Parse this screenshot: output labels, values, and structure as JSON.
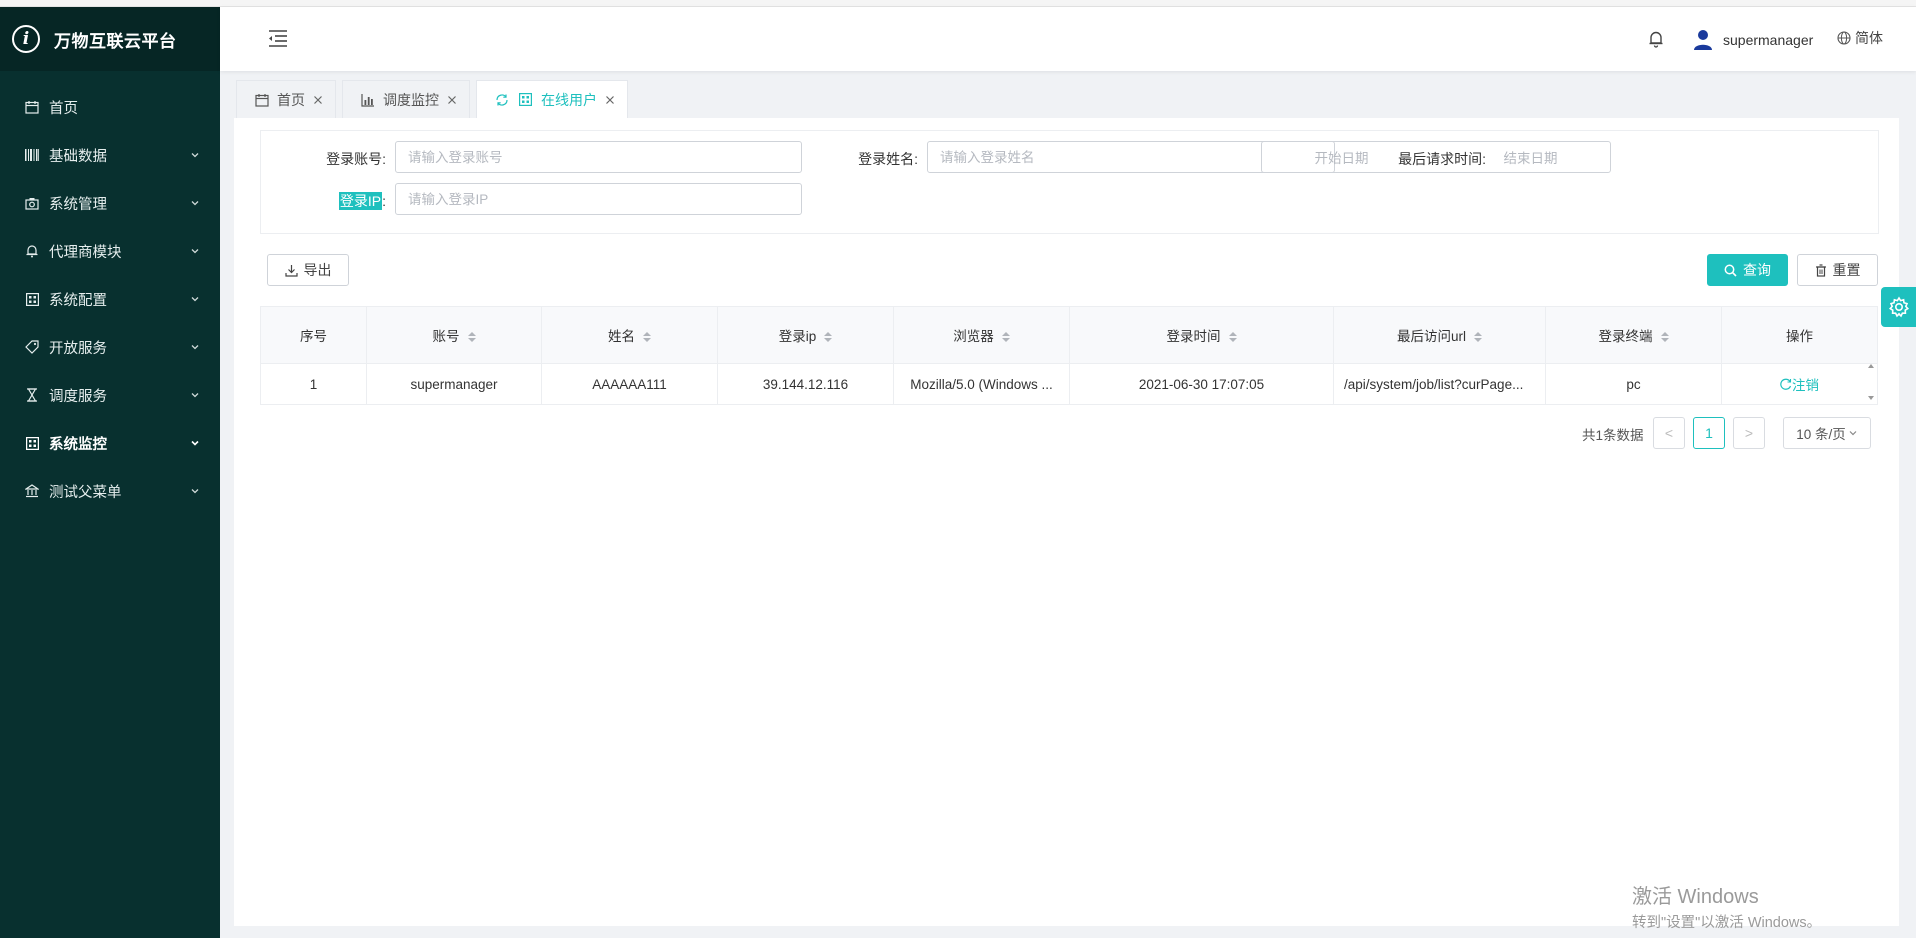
{
  "app": {
    "title": "万物互联云平台"
  },
  "sidebar": {
    "items": [
      {
        "label": "首页",
        "icon": "calendar-icon",
        "has_children": false,
        "active": false
      },
      {
        "label": "基础数据",
        "icon": "barcode-icon",
        "has_children": true,
        "active": false
      },
      {
        "label": "系统管理",
        "icon": "camera-icon",
        "has_children": true,
        "active": false
      },
      {
        "label": "代理商模块",
        "icon": "bell-icon",
        "has_children": true,
        "active": false
      },
      {
        "label": "系统配置",
        "icon": "grid-icon",
        "has_children": true,
        "active": false
      },
      {
        "label": "开放服务",
        "icon": "tag-icon",
        "has_children": true,
        "active": false
      },
      {
        "label": "调度服务",
        "icon": "hourglass-icon",
        "has_children": true,
        "active": false
      },
      {
        "label": "系统监控",
        "icon": "monitor-grid-icon",
        "has_children": true,
        "active": true
      },
      {
        "label": "测试父菜单",
        "icon": "bank-icon",
        "has_children": true,
        "active": false
      }
    ]
  },
  "header": {
    "username": "supermanager",
    "language": "简体"
  },
  "tabs": [
    {
      "label": "首页",
      "icon": "calendar-icon",
      "active": false
    },
    {
      "label": "调度监控",
      "icon": "bar-chart-icon",
      "active": false
    },
    {
      "label": "在线用户",
      "icon": "grid-icon",
      "active": true
    }
  ],
  "search": {
    "account_label": "登录账号:",
    "account_placeholder": "请输入登录账号",
    "name_label": "登录姓名:",
    "name_placeholder": "请输入登录姓名",
    "time_label": "最后请求时间:",
    "start_placeholder": "开始日期",
    "range_sep": "~",
    "end_placeholder": "结束日期",
    "ip_label_highlight": "登录IP",
    "ip_label_rest": ":",
    "ip_placeholder": "请输入登录IP"
  },
  "toolbar": {
    "export_label": "导出",
    "query_label": "查询",
    "reset_label": "重置"
  },
  "table": {
    "columns": [
      "序号",
      "账号",
      "姓名",
      "登录ip",
      "浏览器",
      "登录时间",
      "最后访问url",
      "登录终端",
      "操作"
    ],
    "rows": [
      {
        "index": "1",
        "account": "supermanager",
        "name": "AAAAAA111",
        "ip": "39.144.12.116",
        "browser": "Mozilla/5.0 (Windows ...",
        "login_time": "2021-06-30 17:07:05",
        "last_url": "/api/system/job/list?curPage...",
        "terminal": "pc",
        "action": "注销"
      }
    ]
  },
  "pagination": {
    "total_text": "共1条数据",
    "current_page": "1",
    "prev": "<",
    "next": ">",
    "page_size": "10 条/页"
  },
  "watermark": {
    "line1": "激活 Windows",
    "line2": "转到\"设置\"以激活 Windows。"
  },
  "colors": {
    "sidebar_bg": "#08302f",
    "accent": "#1ec0be"
  }
}
